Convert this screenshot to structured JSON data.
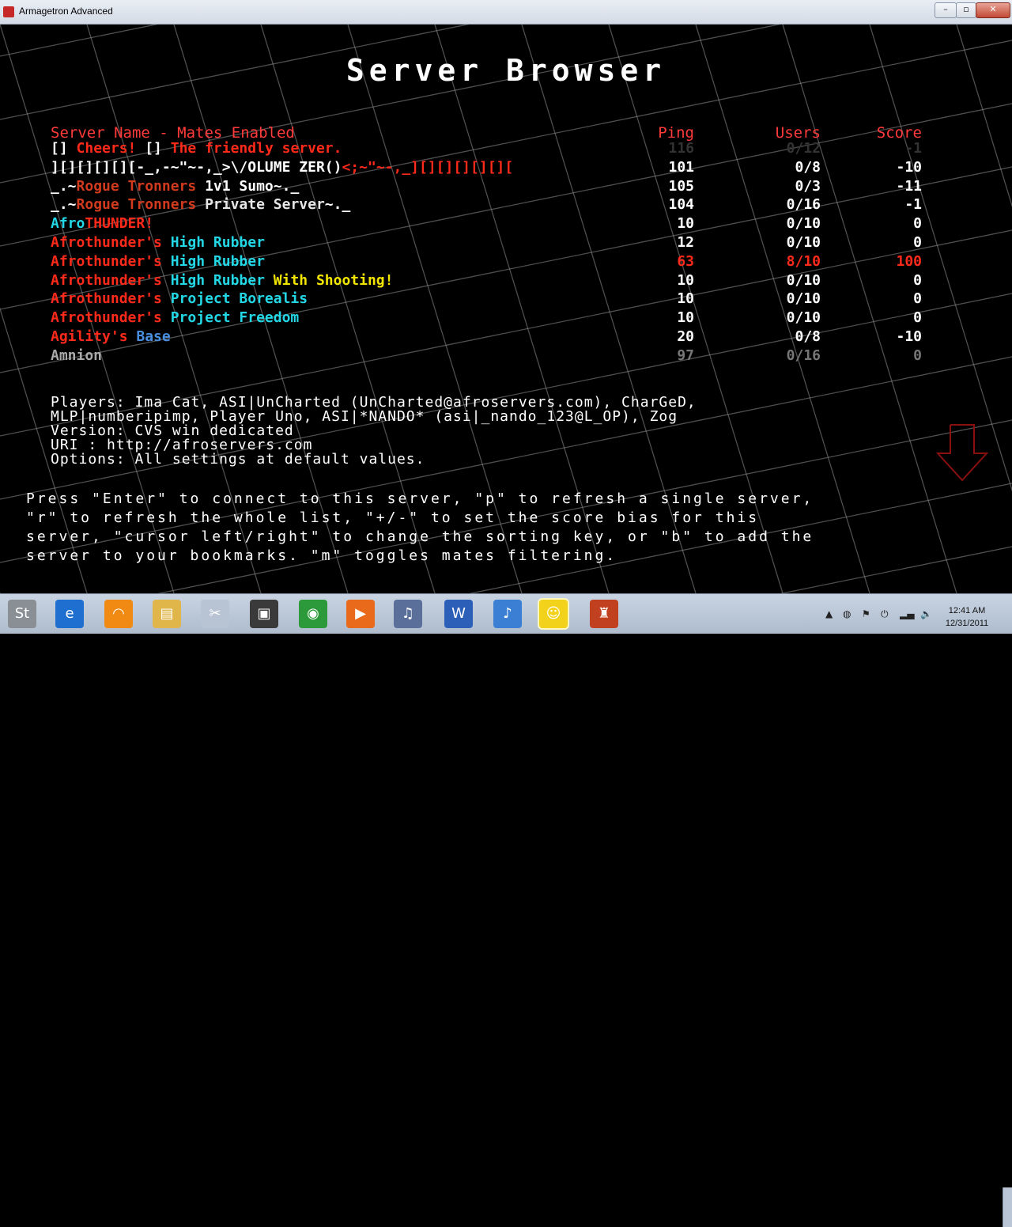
{
  "window": {
    "title": "Armagetron Advanced",
    "minimize": "–",
    "maximize": "▫",
    "close": "✕"
  },
  "screen_title": "Server Browser",
  "headers": {
    "name": "Server Name - Mates Enabled",
    "ping": "Ping",
    "users": "Users",
    "score": "Score"
  },
  "servers": [
    {
      "name": [
        {
          "t": "[] ",
          "c": "#ffffff"
        },
        {
          "t": "Cheers! ",
          "c": "#ff2a1a"
        },
        {
          "t": "[] ",
          "c": "#ffffff"
        },
        {
          "t": "The friendly server.",
          "c": "#ff2a1a"
        }
      ],
      "ping": "116",
      "users": "0/12",
      "score": "-1",
      "color": "#333333"
    },
    {
      "name": [
        {
          "t": "][][][][][-_,-~\"~-,_>",
          "c": "#ffffff"
        },
        {
          "t": "\\/OLUME ZER()",
          "c": "#ffffff"
        },
        {
          "t": "<;~\"~-,_][][][][][][",
          "c": "#ff2a1a"
        }
      ],
      "ping": "101",
      "users": "0/8",
      "score": "-10",
      "color": "#ffffff"
    },
    {
      "name": [
        {
          "t": "_.~",
          "c": "#ffffff"
        },
        {
          "t": "Rogue Tronners ",
          "c": "#d23a1e"
        },
        {
          "t": "1v1 Sumo",
          "c": "#ffffff"
        },
        {
          "t": "~._",
          "c": "#ffffff"
        }
      ],
      "ping": "105",
      "users": "0/3",
      "score": "-11",
      "color": "#ffffff"
    },
    {
      "name": [
        {
          "t": "_.~",
          "c": "#ffffff"
        },
        {
          "t": "Rogue Tronners ",
          "c": "#d23a1e"
        },
        {
          "t": "Private Server",
          "c": "#e6e6e6"
        },
        {
          "t": "~._",
          "c": "#ffffff"
        }
      ],
      "ping": "104",
      "users": "0/16",
      "score": "-1",
      "color": "#ffffff"
    },
    {
      "name": [
        {
          "t": "Afro",
          "c": "#23d8e6"
        },
        {
          "t": "THUNDER!",
          "c": "#ff2a1a"
        }
      ],
      "ping": "10",
      "users": "0/10",
      "score": "0",
      "color": "#ffffff"
    },
    {
      "name": [
        {
          "t": "Afrothunder's ",
          "c": "#ff2a1a"
        },
        {
          "t": "High Rubber",
          "c": "#23d8e6"
        }
      ],
      "ping": "12",
      "users": "0/10",
      "score": "0",
      "color": "#ffffff"
    },
    {
      "name": [
        {
          "t": "Afrothunder's ",
          "c": "#ff2a1a"
        },
        {
          "t": "High Rubber",
          "c": "#23d8e6"
        }
      ],
      "ping": "63",
      "users": "8/10",
      "score": "100",
      "color": "#ff2a1a"
    },
    {
      "name": [
        {
          "t": "Afrothunder's ",
          "c": "#ff2a1a"
        },
        {
          "t": "High Rubber ",
          "c": "#23d8e6"
        },
        {
          "t": "With Shooting!",
          "c": "#f2e600"
        }
      ],
      "ping": "10",
      "users": "0/10",
      "score": "0",
      "color": "#ffffff"
    },
    {
      "name": [
        {
          "t": "Afrothunder's ",
          "c": "#ff2a1a"
        },
        {
          "t": "Project Borealis",
          "c": "#23d8e6"
        }
      ],
      "ping": "10",
      "users": "0/10",
      "score": "0",
      "color": "#ffffff"
    },
    {
      "name": [
        {
          "t": "Afrothunder's ",
          "c": "#ff2a1a"
        },
        {
          "t": "Project Freedom",
          "c": "#23d8e6"
        }
      ],
      "ping": "10",
      "users": "0/10",
      "score": "0",
      "color": "#ffffff"
    },
    {
      "name": [
        {
          "t": "Agility's ",
          "c": "#ff2a1a"
        },
        {
          "t": "Base",
          "c": "#4a8ee0"
        }
      ],
      "ping": "20",
      "users": "0/8",
      "score": "-10",
      "color": "#ffffff"
    },
    {
      "name": [
        {
          "t": "Amnion",
          "c": "#aaaaaa"
        }
      ],
      "ping": "97",
      "users": "0/16",
      "score": "0",
      "color": "#777777"
    }
  ],
  "details": {
    "players_1": "Players: Ima Cat, ASI|UnCharted (UnCharted@afroservers.com), CharGeD,",
    "players_2": "MLP|numberipimp, Player Uno, ASI|*NANDO* (asi|_nando_123@L_OP), Zog",
    "version": "Version: CVS win dedicated",
    "uri": "URI     : http://afroservers.com",
    "options": "Options: All settings at default values."
  },
  "help": {
    "line1": "Press \"Enter\" to connect to this server, \"p\" to refresh a single server,",
    "line2": "\"r\" to refresh the whole list, \"+/-\" to set the score bias for this",
    "line3": "server, \"cursor left/right\" to change the sorting key, or \"b\" to add the",
    "line4": "server to your bookmarks. \"m\" toggles mates filtering."
  },
  "taskbar": {
    "items": [
      {
        "name": "taskbar-start-icon",
        "glyph": "St",
        "bg": "#8a8f96"
      },
      {
        "name": "taskbar-ie-icon",
        "glyph": "e",
        "bg": "#1e6fd0"
      },
      {
        "name": "taskbar-orange-app-icon",
        "glyph": "◠",
        "bg": "#f08a12"
      },
      {
        "name": "taskbar-explorer-icon",
        "glyph": "▤",
        "bg": "#e0b54a"
      },
      {
        "name": "taskbar-scissors-icon",
        "glyph": "✂",
        "bg": "#b8c3d3"
      },
      {
        "name": "taskbar-terminal-icon",
        "glyph": "▣",
        "bg": "#3a3a3a"
      },
      {
        "name": "taskbar-eye-icon",
        "glyph": "◉",
        "bg": "#2c9a3a"
      },
      {
        "name": "taskbar-media-icon",
        "glyph": "▶",
        "bg": "#e86a1a"
      },
      {
        "name": "taskbar-music-icon",
        "glyph": "♫",
        "bg": "#5a6f9a"
      },
      {
        "name": "taskbar-word-icon",
        "glyph": "W",
        "bg": "#2b5fb8"
      },
      {
        "name": "taskbar-itunes-icon",
        "glyph": "♪",
        "bg": "#3b7fd4"
      },
      {
        "name": "taskbar-game-active-icon",
        "glyph": "☺",
        "bg": "#f2d21a"
      },
      {
        "name": "taskbar-armagetron-icon",
        "glyph": "♜",
        "bg": "#c04020"
      }
    ],
    "clock_time": "12:41 AM",
    "clock_date": "12/31/2011"
  }
}
